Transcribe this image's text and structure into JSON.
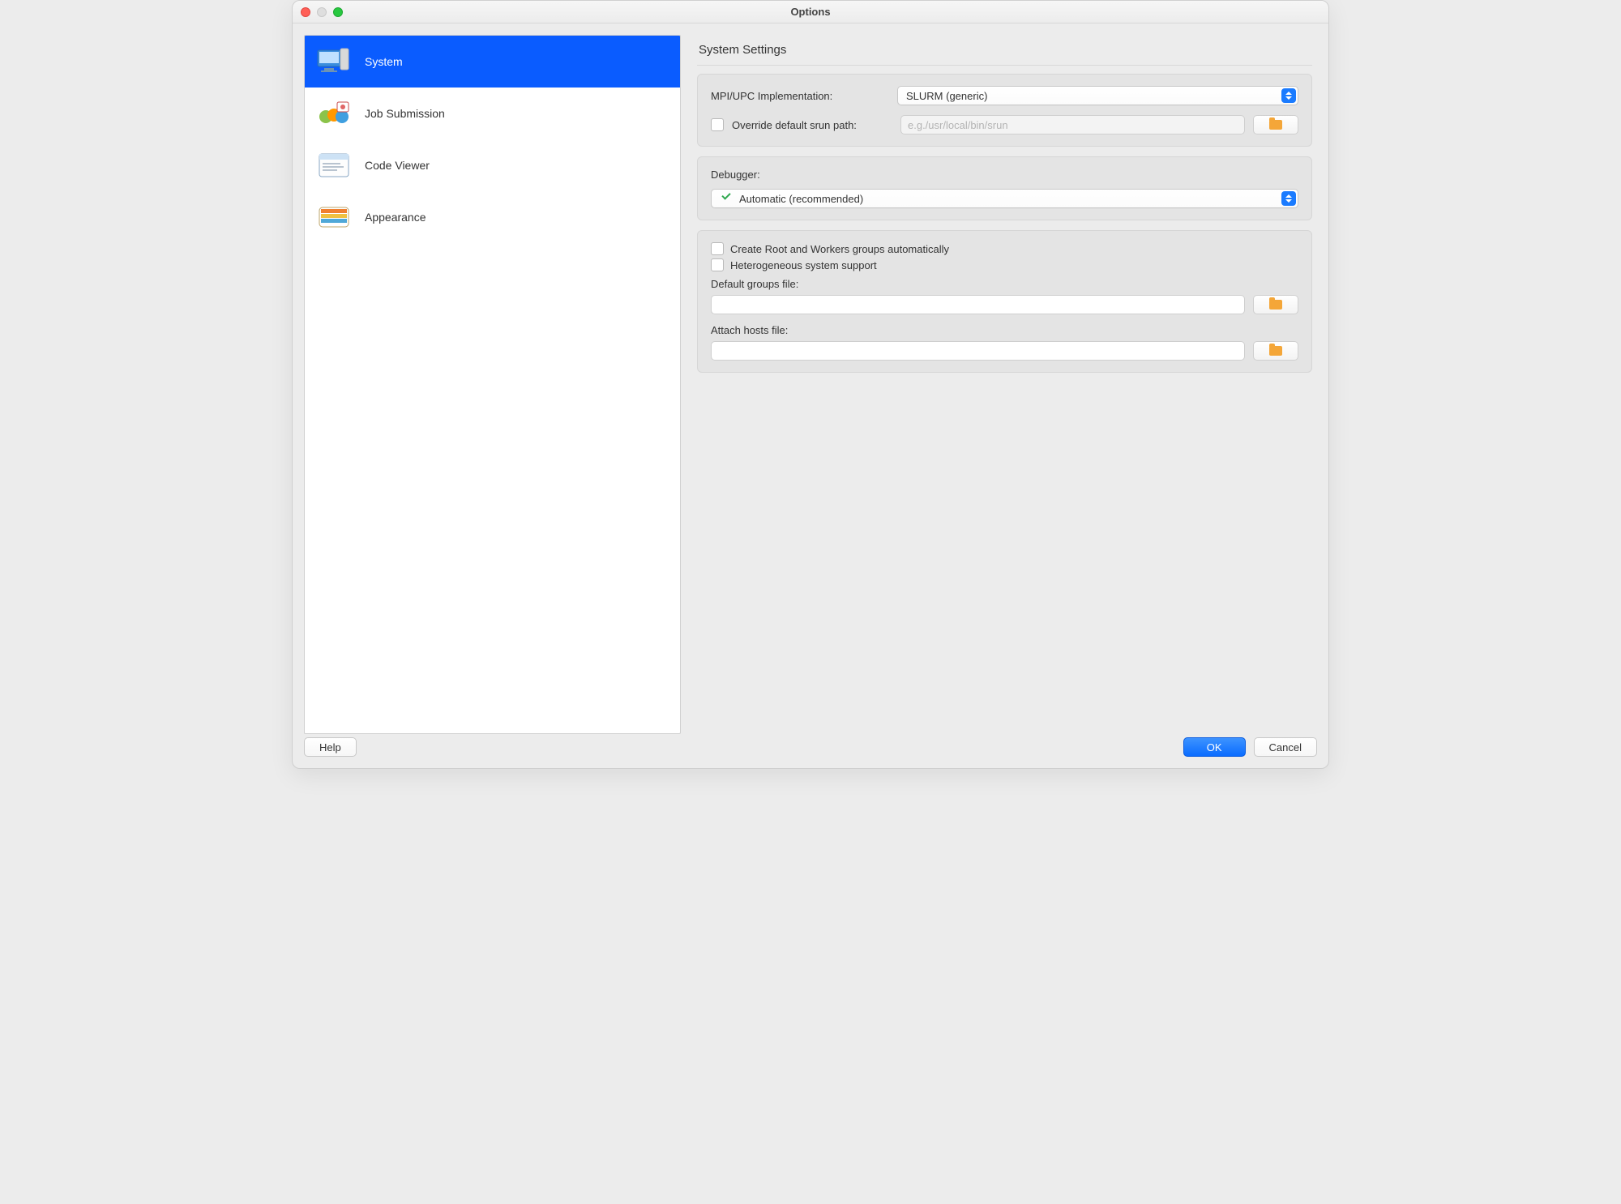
{
  "window": {
    "title": "Options"
  },
  "sidebar": [
    {
      "id": "system",
      "label": "System",
      "selected": true
    },
    {
      "id": "job-submission",
      "label": "Job Submission",
      "selected": false
    },
    {
      "id": "code-viewer",
      "label": "Code Viewer",
      "selected": false
    },
    {
      "id": "appearance",
      "label": "Appearance",
      "selected": false
    }
  ],
  "panel": {
    "title": "System Settings",
    "mpi": {
      "label": "MPI/UPC Implementation:",
      "selected": "SLURM (generic)",
      "override_label": "Override default srun path:",
      "override_checked": false,
      "srun_placeholder": "e.g./usr/local/bin/srun",
      "srun_value": ""
    },
    "debugger": {
      "label": "Debugger:",
      "selected": "Automatic (recommended)"
    },
    "groups": {
      "create_root_label": "Create Root and Workers groups automatically",
      "create_root_checked": false,
      "hetero_label": "Heterogeneous system support",
      "hetero_checked": false,
      "default_groups_label": "Default groups file:",
      "default_groups_value": "",
      "attach_hosts_label": "Attach hosts file:",
      "attach_hosts_value": ""
    }
  },
  "buttons": {
    "help": "Help",
    "ok": "OK",
    "cancel": "Cancel"
  }
}
